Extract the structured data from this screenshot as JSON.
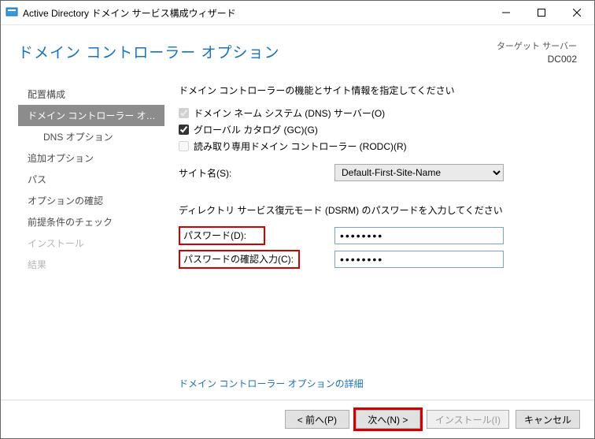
{
  "window": {
    "title": "Active Directory ドメイン サービス構成ウィザード"
  },
  "header": {
    "page_title": "ドメイン コントローラー オプション",
    "target_label": "ターゲット サーバー",
    "target_server": "DC002"
  },
  "nav": {
    "items": [
      {
        "label": "配置構成",
        "kind": "item"
      },
      {
        "label": "ドメイン コントローラー オプシ...",
        "kind": "selected"
      },
      {
        "label": "DNS オプション",
        "kind": "child"
      },
      {
        "label": "追加オプション",
        "kind": "item"
      },
      {
        "label": "パス",
        "kind": "item"
      },
      {
        "label": "オプションの確認",
        "kind": "item"
      },
      {
        "label": "前提条件のチェック",
        "kind": "item"
      },
      {
        "label": "インストール",
        "kind": "disabled"
      },
      {
        "label": "結果",
        "kind": "disabled"
      }
    ]
  },
  "content": {
    "instruction1": "ドメイン コントローラーの機能とサイト情報を指定してください",
    "chk_dns": "ドメイン ネーム システム (DNS) サーバー(O)",
    "chk_gc": "グローバル カタログ (GC)(G)",
    "chk_rodc": "読み取り専用ドメイン コントローラー (RODC)(R)",
    "site_label": "サイト名(S):",
    "site_value": "Default-First-Site-Name",
    "instruction2": "ディレクトリ サービス復元モード (DSRM) のパスワードを入力してください",
    "pw_label": "パスワード(D):",
    "pw_confirm_label": "パスワードの確認入力(C):",
    "pw_value": "••••••••",
    "more_link": "ドメイン コントローラー オプションの詳細"
  },
  "footer": {
    "prev": "< 前へ(P)",
    "next": "次へ(N) >",
    "install": "インストール(I)",
    "cancel": "キャンセル"
  }
}
